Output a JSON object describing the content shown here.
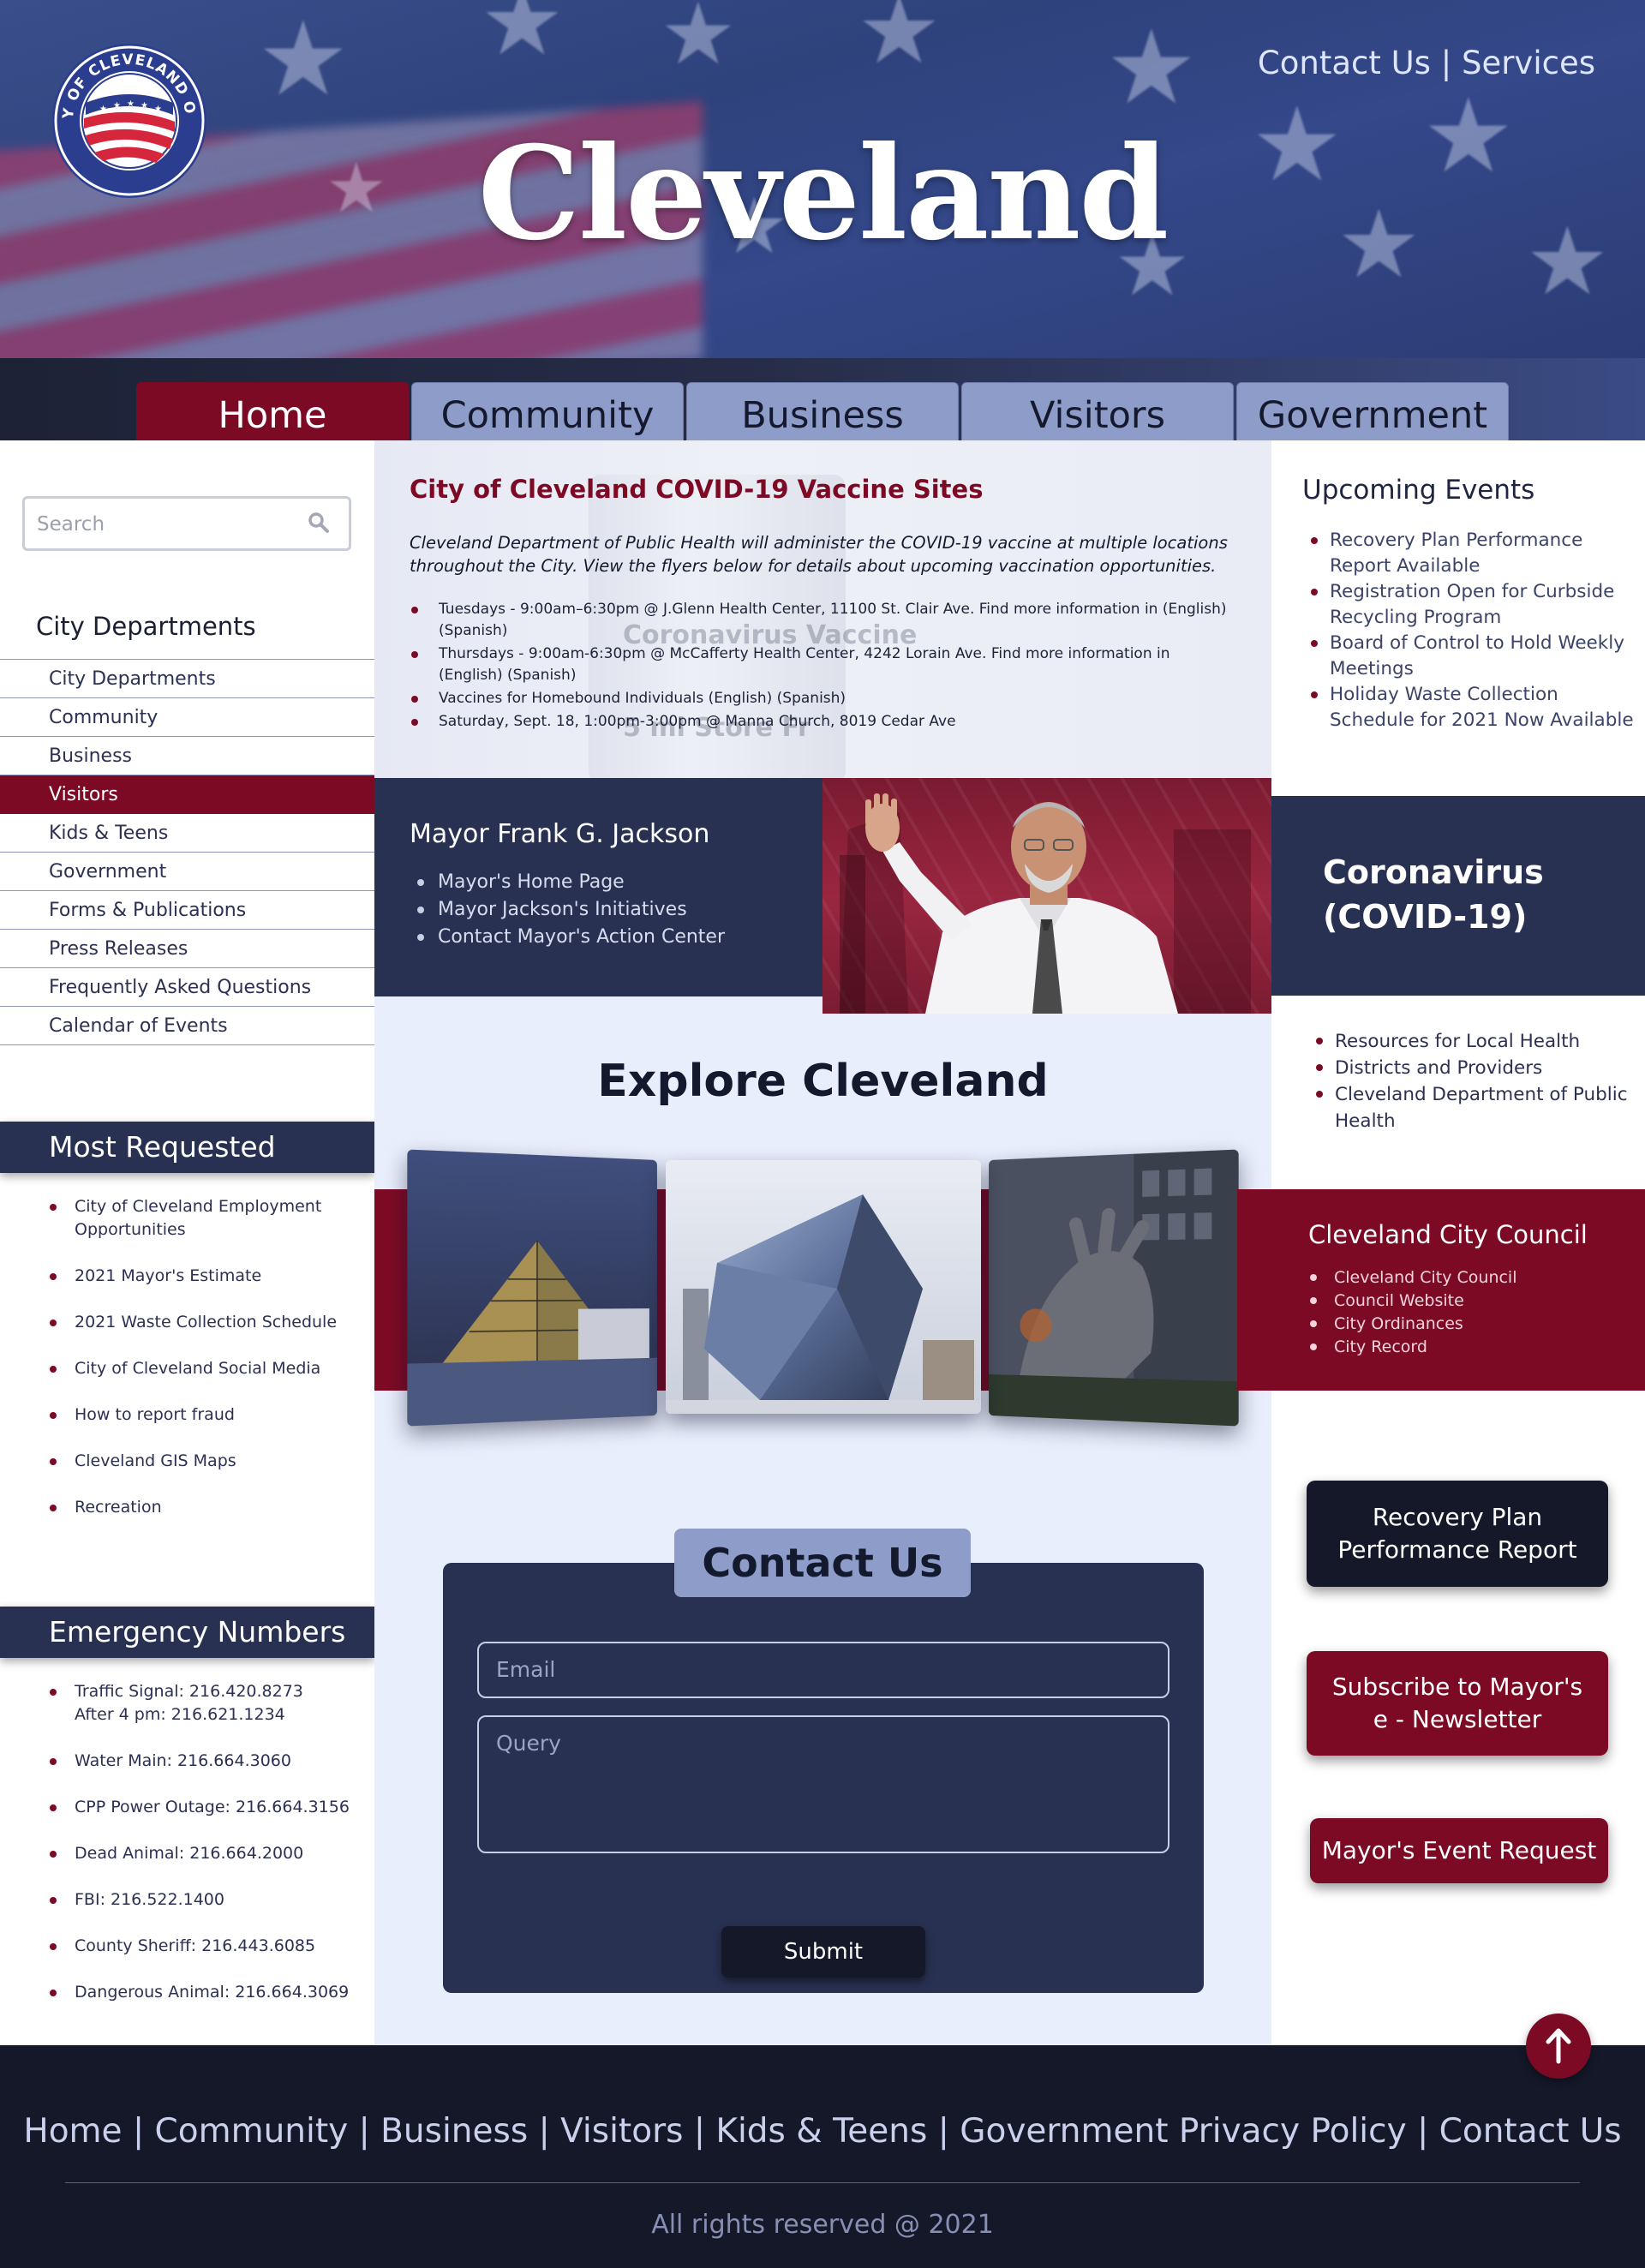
{
  "header": {
    "title": "Cleveland",
    "seal_text": "CITY OF CLEVELAND OHIO",
    "top_links": [
      "Contact Us",
      "Services"
    ],
    "top_links_separator": "|"
  },
  "nav": {
    "tabs": [
      {
        "label": "Home",
        "active": true
      },
      {
        "label": "Community",
        "active": false
      },
      {
        "label": "Business",
        "active": false
      },
      {
        "label": "Visitors",
        "active": false
      },
      {
        "label": "Government",
        "active": false
      }
    ]
  },
  "sidebar": {
    "search_placeholder": "Search",
    "departments_heading": "City Departments",
    "departments": [
      {
        "label": "City Departments",
        "active": false
      },
      {
        "label": "Community",
        "active": false
      },
      {
        "label": "Business",
        "active": false
      },
      {
        "label": "Visitors",
        "active": true
      },
      {
        "label": "Kids & Teens",
        "active": false
      },
      {
        "label": "Government",
        "active": false
      },
      {
        "label": "Forms & Publications",
        "active": false
      },
      {
        "label": "Press Releases",
        "active": false
      },
      {
        "label": "Frequently Asked Questions",
        "active": false
      },
      {
        "label": "Calendar of Events",
        "active": false
      }
    ],
    "most_requested_title": "Most Requested",
    "most_requested": [
      "City of Cleveland Employment Opportunities",
      "2021 Mayor's Estimate",
      "2021 Waste Collection Schedule",
      "City of Cleveland Social Media",
      "How to report fraud",
      "Cleveland GIS Maps",
      "Recreation"
    ],
    "emergency_title": "Emergency Numbers",
    "emergency": [
      {
        "line1": "Traffic Signal: 216.420.8273",
        "line2": "After 4 pm: 216.621.1234"
      },
      {
        "line1": "Water Main: 216.664.3060",
        "line2": ""
      },
      {
        "line1": "CPP Power Outage: 216.664.3156",
        "line2": ""
      },
      {
        "line1": "Dead Animal: 216.664.2000",
        "line2": ""
      },
      {
        "line1": "FBI: 216.522.1400",
        "line2": ""
      },
      {
        "line1": "County Sheriff: 216.443.6085",
        "line2": ""
      },
      {
        "line1": "Dangerous Animal: 216.664.3069",
        "line2": ""
      }
    ]
  },
  "vaccine": {
    "title": "City of Cleveland COVID-19 Vaccine Sites",
    "intro": "Cleveland Department of Public Health will administer the COVID-19 vaccine at multiple locations throughout the City. View the flyers below for details about upcoming vaccination opportunities.",
    "vial_label": "Coronavirus Vaccine",
    "vial_volume": "5 ml Store Fr",
    "sites": [
      "Tuesdays - 9:00am–6:30pm @ J.Glenn Health Center, 11100 St. Clair Ave. Find more information in (English) (Spanish)",
      "Thursdays - 9:00am-6:30pm @ McCafferty Health Center, 4242 Lorain Ave. Find more information in (English) (Spanish)",
      "Vaccines for Homebound Individuals (English) (Spanish)",
      "Saturday, Sept. 18, 1:00pm-3:00pm @ Manna Church, 8019 Cedar Ave"
    ]
  },
  "mayor": {
    "name": "Mayor Frank G. Jackson",
    "links": [
      "Mayor's Home Page",
      "Mayor Jackson's Initiatives",
      "Contact Mayor's Action Center"
    ]
  },
  "explore": {
    "title": "Explore Cleveland"
  },
  "contact": {
    "title": "Contact Us",
    "email_placeholder": "Email",
    "query_placeholder": "Query",
    "submit_label": "Submit"
  },
  "right": {
    "events_title": "Upcoming Events",
    "events": [
      "Recovery Plan Performance Report Available",
      "Registration Open for Curbside Recycling Program",
      "Board of Control to Hold Weekly Meetings",
      "Holiday Waste Collection Schedule for 2021 Now Available"
    ],
    "covid_title": "Coronavirus (COVID-19)",
    "covid_links": [
      "Resources for Local Health",
      "Districts and Providers",
      "Cleveland Department of Public Health"
    ],
    "council_title": "Cleveland City Council",
    "council_links": [
      "Cleveland City Council",
      "Council Website",
      "City Ordinances",
      "City Record"
    ],
    "cta_recovery": "Recovery Plan Performance Report",
    "cta_newsletter": "Subscribe to Mayor's e - Newsletter",
    "cta_event": "Mayor's Event Request"
  },
  "footer": {
    "links": [
      "Home",
      "Community",
      "Business",
      "Visitors",
      "Kids & Teens",
      "Government Privacy Policy",
      "Contact Us"
    ],
    "separator": "|",
    "copyright": "All rights reserved @ 2021"
  },
  "colors": {
    "brand_maroon": "#7d0a25",
    "navy": "#283152",
    "nav_tab": "#8d9cc9",
    "center_bg": "#e8eefc",
    "footer_bg": "#141828"
  },
  "icons": [
    "seal-logo-icon",
    "search-icon",
    "arrow-up-icon"
  ]
}
